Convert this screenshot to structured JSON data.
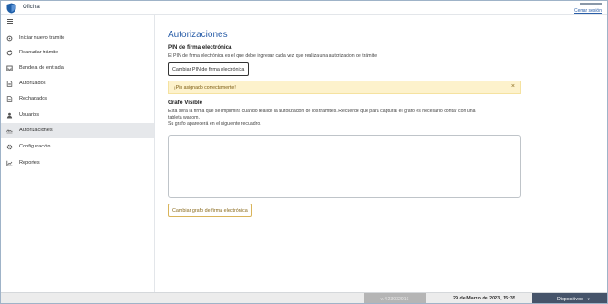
{
  "header": {
    "app_title": "Oficina",
    "logout_label": "Cerrar sesión"
  },
  "sidebar": {
    "items": [
      {
        "label": "Iniciar nuevo trámite",
        "icon": "gear-icon"
      },
      {
        "label": "Reanudar trámite",
        "icon": "refresh-icon"
      },
      {
        "label": "Bandeja de entrada",
        "icon": "inbox-icon"
      },
      {
        "label": "Autorizados",
        "icon": "document-icon"
      },
      {
        "label": "Rechazados",
        "icon": "document-icon"
      },
      {
        "label": "Usuarios",
        "icon": "user-icon"
      },
      {
        "label": "Autorizaciones",
        "icon": "signature-icon",
        "active": true
      },
      {
        "label": "Configuración",
        "icon": "settings-icon"
      },
      {
        "label": "Reportes",
        "icon": "chart-icon"
      }
    ]
  },
  "main": {
    "title": "Autorizaciones",
    "pin_section": {
      "title": "PIN de firma electrónica",
      "description": "El PIN de firma electrónica es el que debe ingresar cada vez que realiza una autorizacion de trámite",
      "button_label": "Cambiar PIN de firma electrónica"
    },
    "alert": {
      "message": "¡Pin asignado correctamente!",
      "close": "×"
    },
    "graph_section": {
      "title": "Grafo Visible",
      "description_line1": "Esta será la firma que se imprimirá cuando realice la autorización de los trámites. Recuerde que para capturar el grafo es necesario contar con una",
      "description_line2": "tableta wacom.",
      "description_line3": "Su grafo aparecerá en el siguiente recuadro.",
      "button_label": "Cambiar grafo de firma electrónica"
    }
  },
  "statusbar": {
    "version": "v.4.23032916",
    "datetime": "29 de Marzo de 2023, 15:35",
    "devices_label": "Dispositivos",
    "devices_caret": "▼"
  },
  "colors": {
    "accent": "#2a5ea8",
    "alert_bg": "#fdf2cc",
    "gold_button": "#d9b45a",
    "devices_bg": "#46546a",
    "active_nav": "#e6e8eb"
  }
}
